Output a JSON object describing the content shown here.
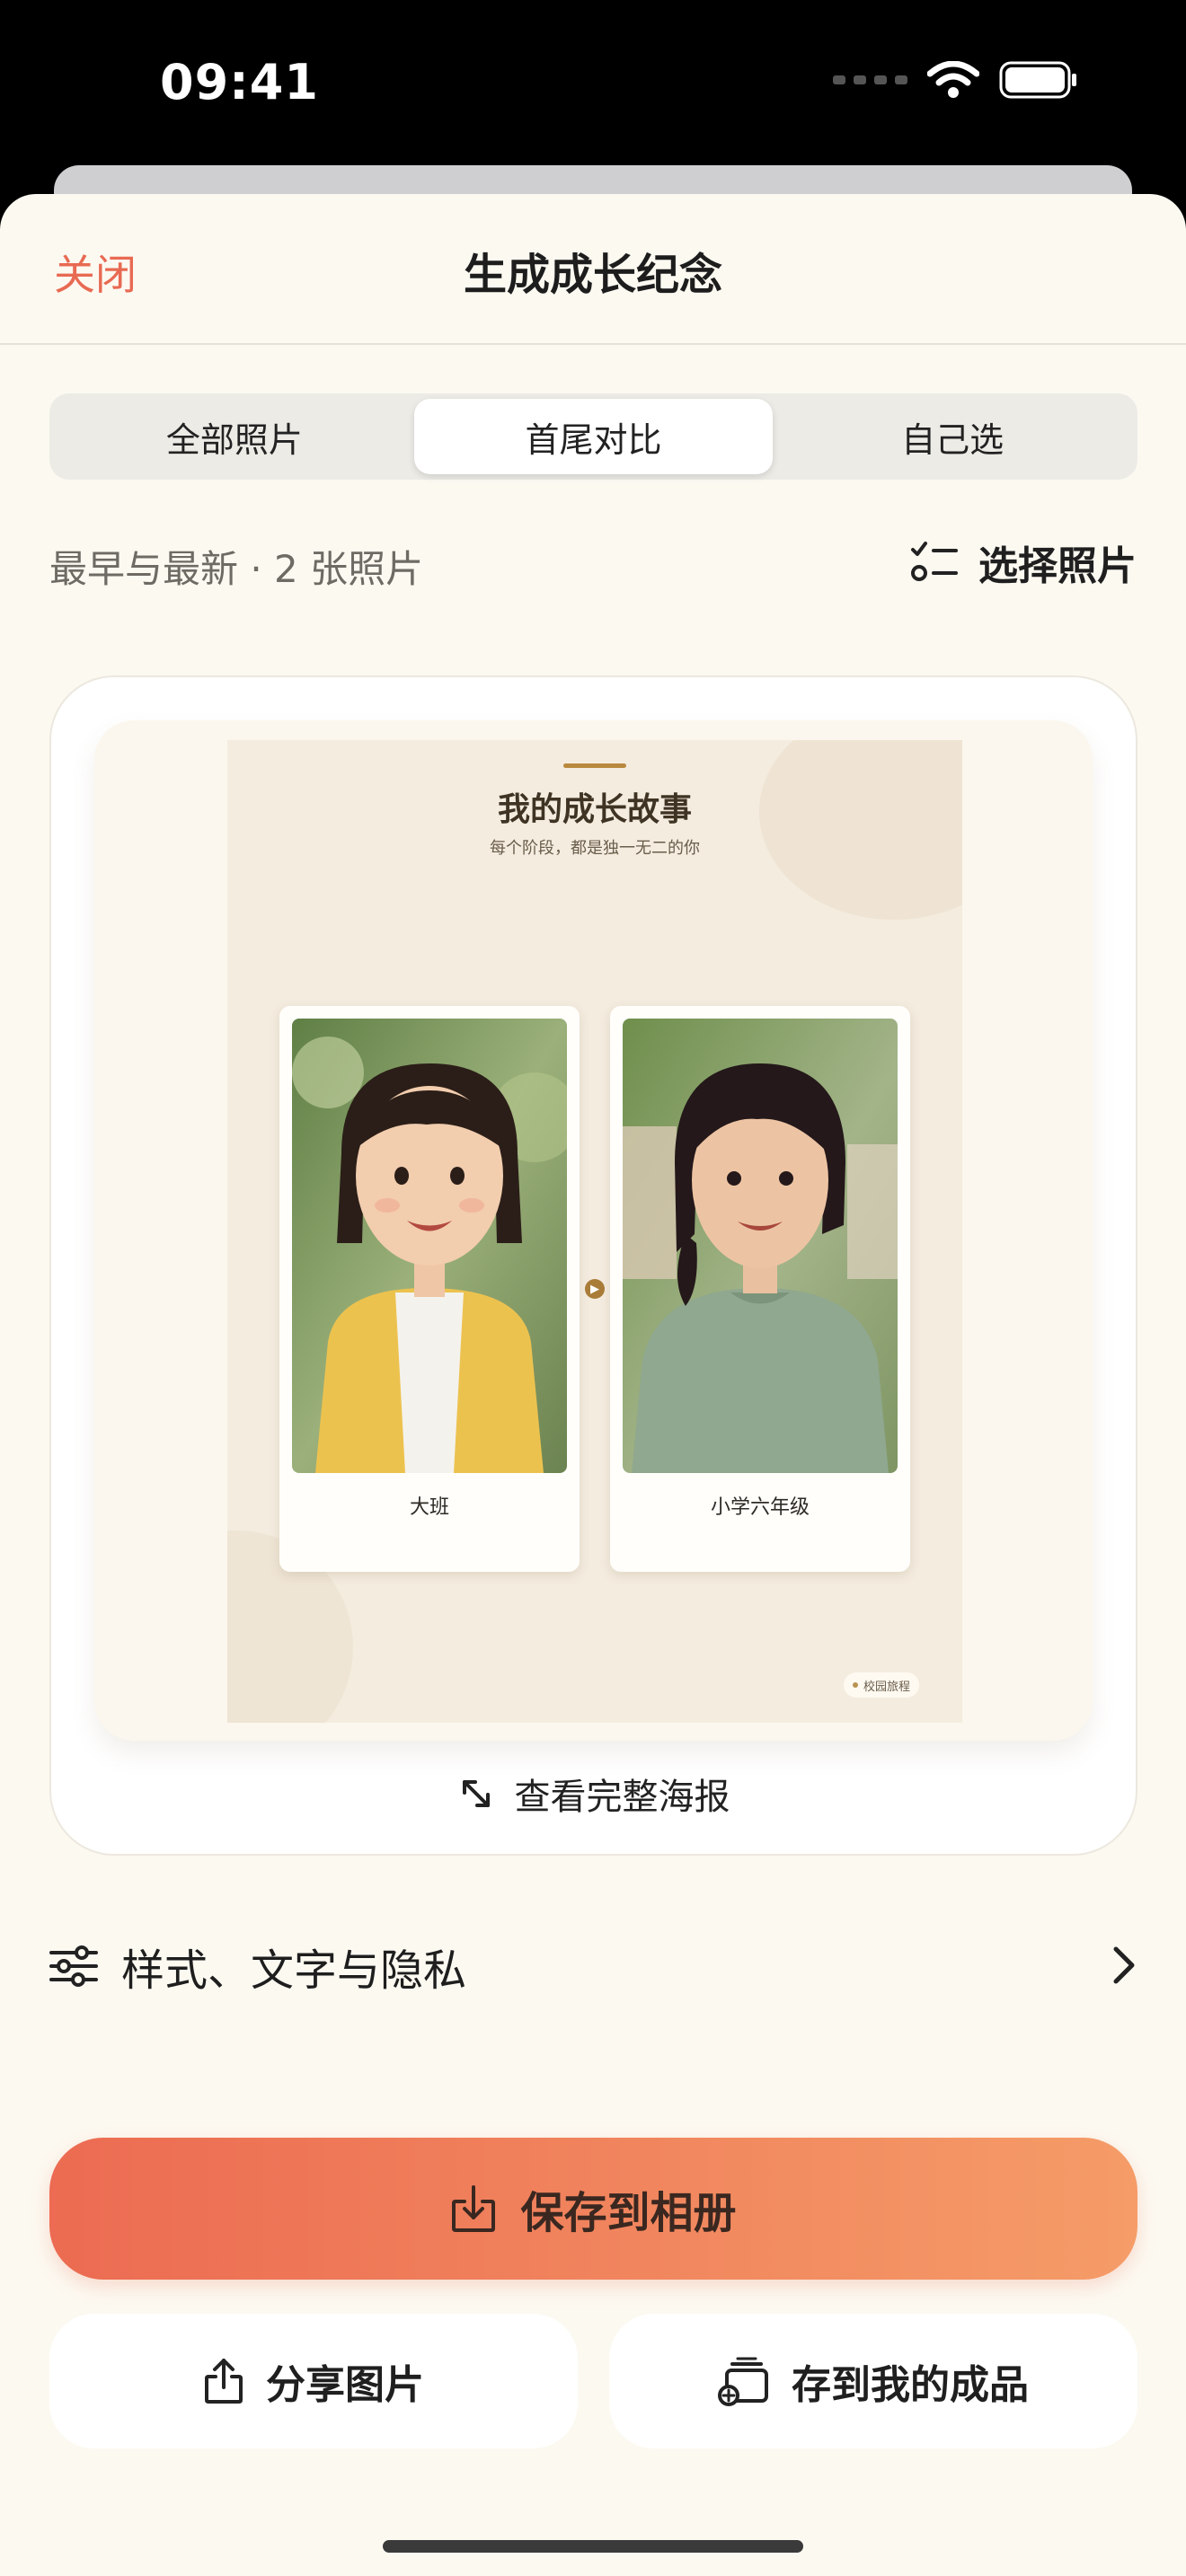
{
  "status_bar": {
    "time": "09:41"
  },
  "nav": {
    "close_label": "关闭",
    "title": "生成成长纪念"
  },
  "segments": [
    {
      "label": "全部照片",
      "active": false
    },
    {
      "label": "首尾对比",
      "active": true
    },
    {
      "label": "自己选",
      "active": false
    }
  ],
  "summary": {
    "count_text": "最早与最新 · 2 张照片",
    "select_label": "选择照片"
  },
  "poster": {
    "title": "我的成长故事",
    "subtitle": "每个阶段，都是独一无二的你",
    "photos": [
      {
        "caption": "大班"
      },
      {
        "caption": "小学六年级"
      }
    ],
    "badge": "校园旅程"
  },
  "preview": {
    "view_full_label": "查看完整海报"
  },
  "style_row": {
    "label": "样式、文字与隐私"
  },
  "actions": {
    "save_label": "保存到相册",
    "share_label": "分享图片",
    "collect_label": "存到我的成品"
  },
  "colors": {
    "accent": "#e86a52",
    "gradient_start": "#ec6b52",
    "gradient_end": "#f59c68",
    "sheet_bg": "#fcf9f1",
    "poster_bg": "#f4ecdf"
  }
}
